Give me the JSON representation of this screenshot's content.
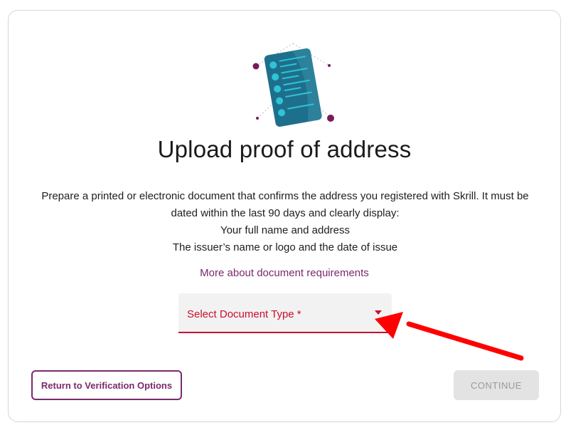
{
  "page": {
    "title": "Upload proof of address",
    "description_lines": [
      "Prepare a printed or electronic document that confirms the address you registered with Skrill. It must be dated within the last 90 days and clearly display:",
      "Your full name and address",
      "The issuer’s name or logo and the date of issue"
    ],
    "more_link": "More about document requirements"
  },
  "document_select": {
    "label": "Select Document Type *",
    "icon": "chevron-down-icon"
  },
  "actions": {
    "return_label": "Return to Verification Options",
    "continue_label": "CONTINUE"
  },
  "annotation": {
    "icon": "red-arrow-pointer",
    "color": "#ff0000"
  },
  "colors": {
    "brand": "#7a2a6c",
    "error": "#c8102e",
    "document_primary": "#1e6f8c",
    "document_accent": "#2ec4d6",
    "disabled_bg": "#e3e3e3"
  }
}
